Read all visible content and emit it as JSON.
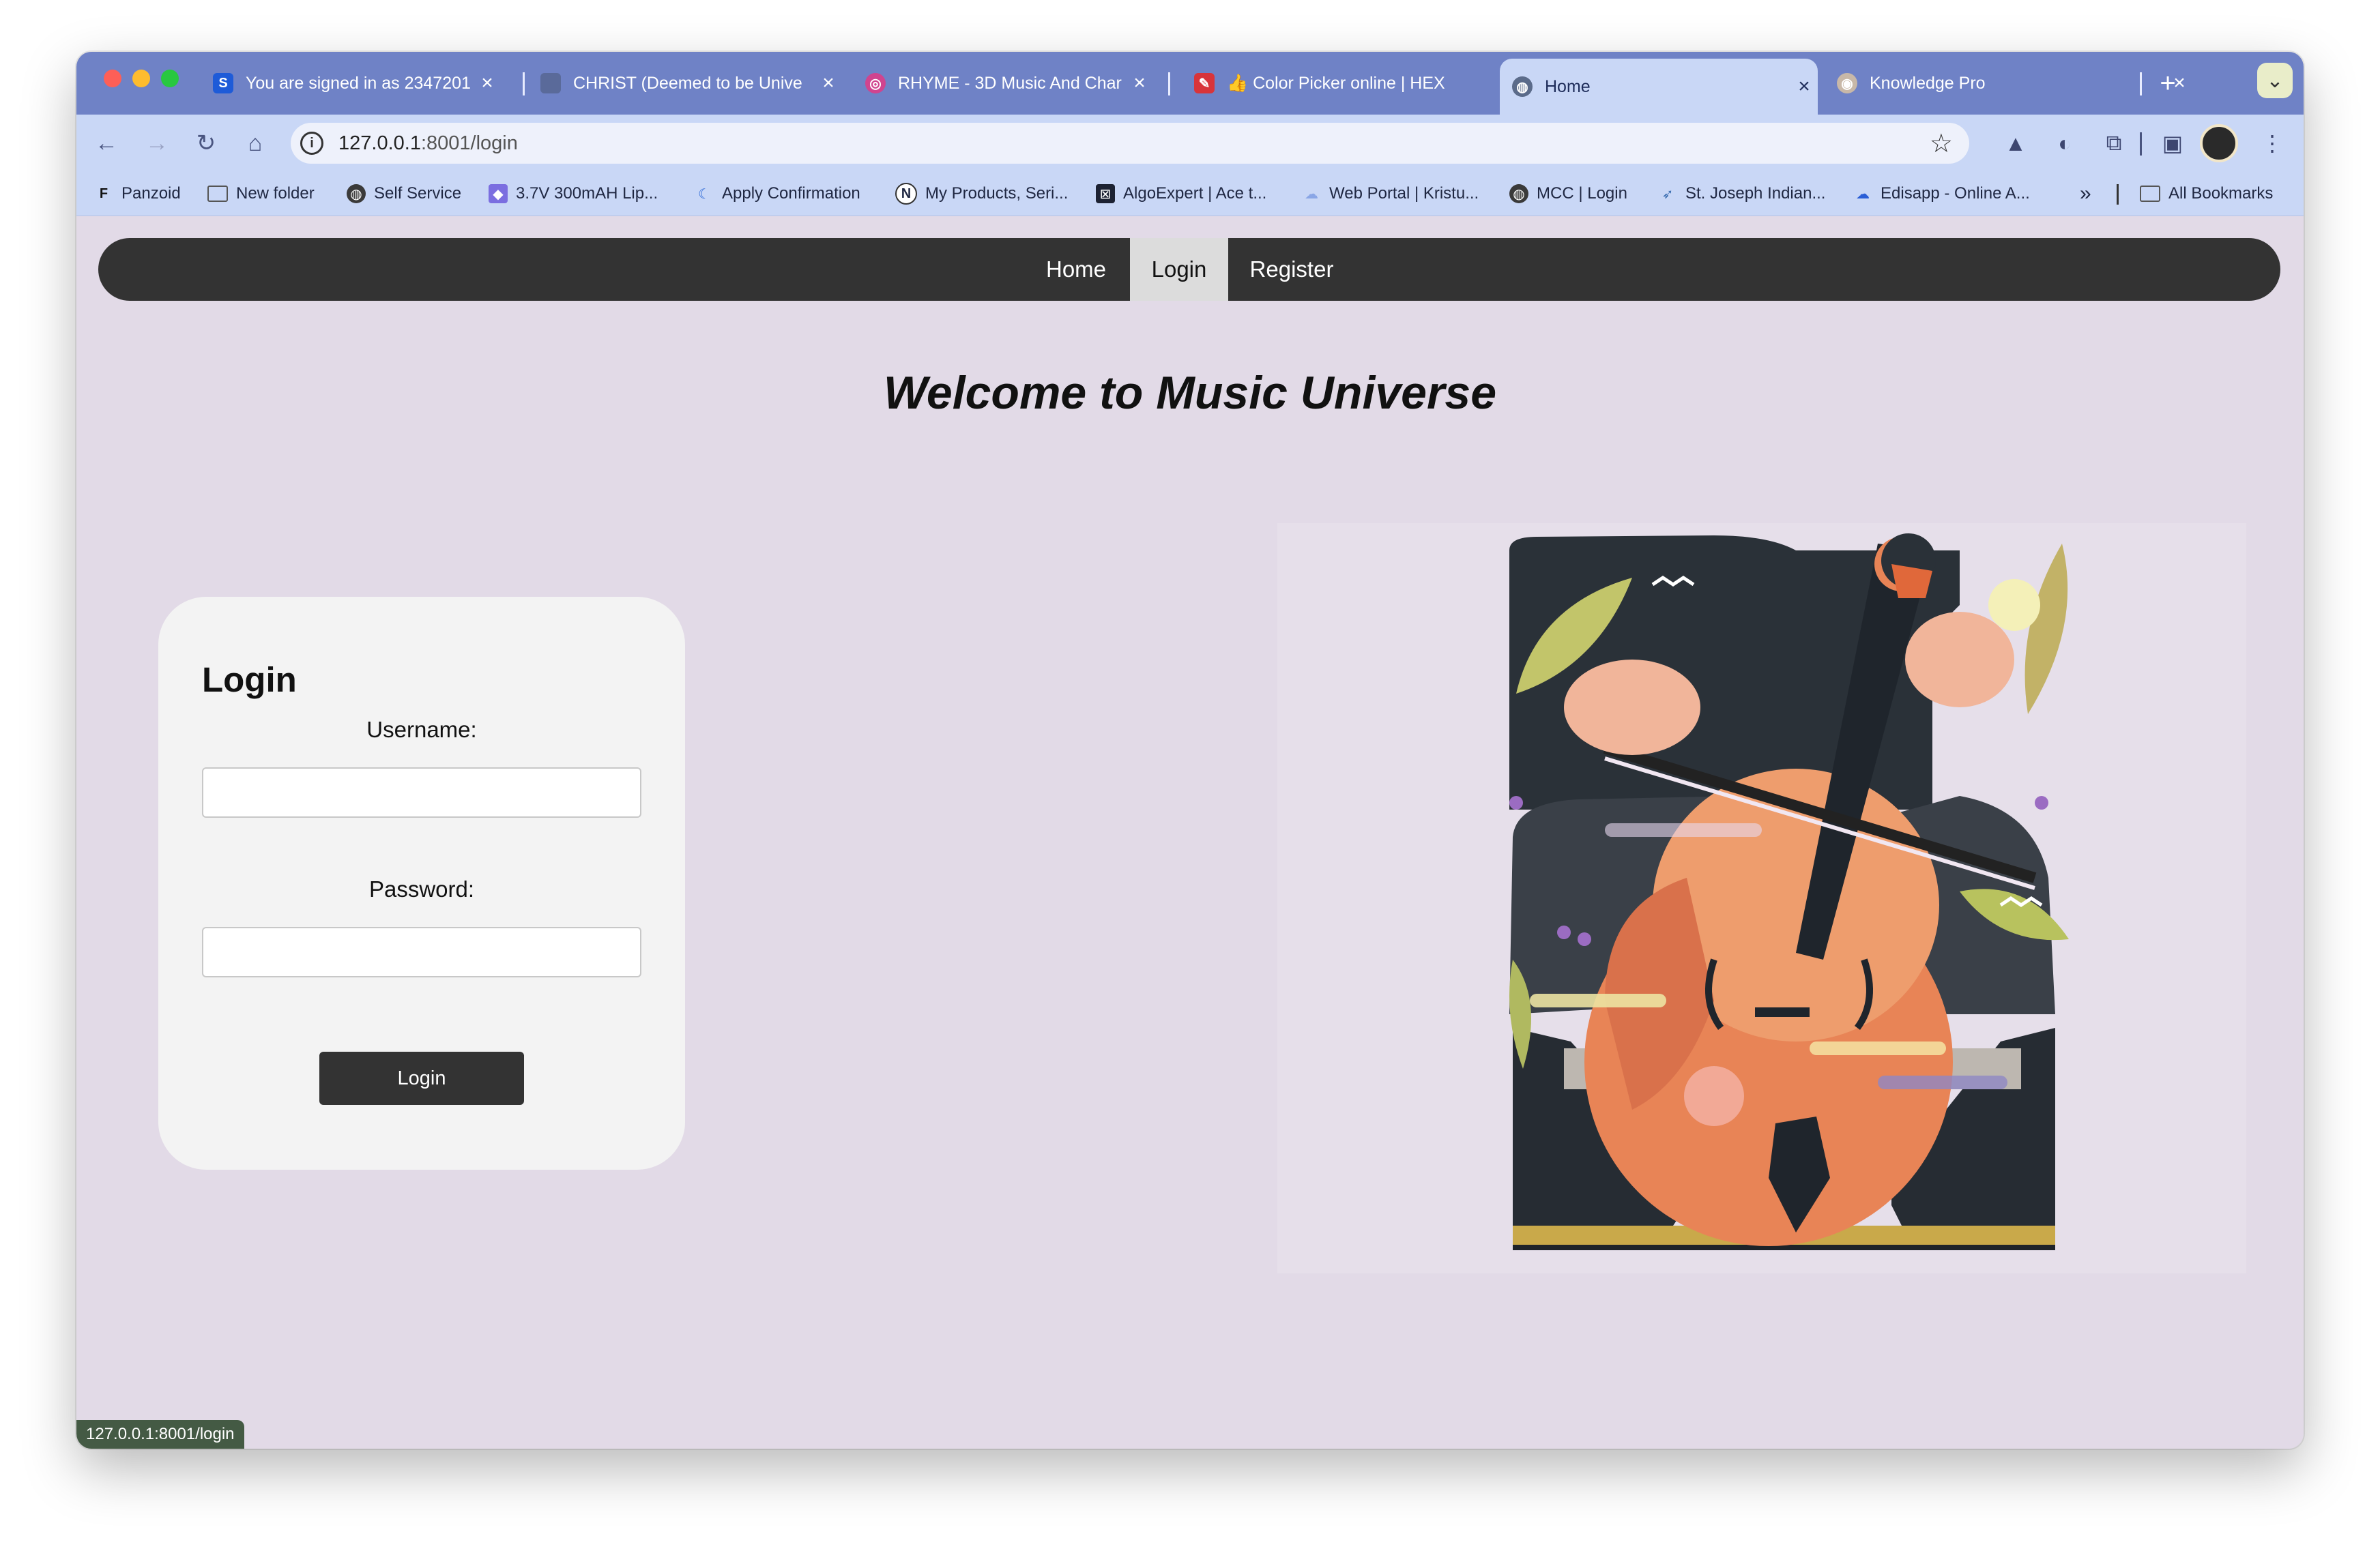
{
  "tabs": [
    {
      "title": "You are signed in as 2347201",
      "favicon": "S",
      "fav_color": "#1e5bd8",
      "active": false
    },
    {
      "title": "CHRIST (Deemed to be Unive",
      "favicon": "",
      "fav_color": "#5a6a9a",
      "active": false
    },
    {
      "title": "RHYME - 3D Music And Char",
      "favicon": "◎",
      "fav_color": "#d0448f",
      "active": false
    },
    {
      "title": "👍 Color Picker online | HEX",
      "favicon": "✎",
      "fav_color": "#d8343a",
      "active": false
    },
    {
      "title": "Home",
      "favicon": "◍",
      "fav_color": "#5b6b8a",
      "active": true
    },
    {
      "title": "Knowledge Pro",
      "favicon": "◉",
      "fav_color": "#c8b8a8",
      "active": false
    }
  ],
  "new_tab_symbol": "+",
  "tab_search_symbol": "⌄",
  "url": {
    "host": "127.0.0.1",
    "rest": ":8001/login"
  },
  "bookmarks": [
    {
      "label": "Panzoid",
      "icon": "F"
    },
    {
      "label": "New folder",
      "icon": "folder"
    },
    {
      "label": "Self Service",
      "icon": "globe"
    },
    {
      "label": "3.7V 300mAH Lip...",
      "icon": "cube"
    },
    {
      "label": "Apply Confirmation",
      "icon": "ruby"
    },
    {
      "label": "My Products, Seri...",
      "icon": "N"
    },
    {
      "label": "AlgoExpert | Ace t...",
      "icon": "X"
    },
    {
      "label": "Web Portal | Kristu...",
      "icon": "cloud"
    },
    {
      "label": "MCC | Login",
      "icon": "globe"
    },
    {
      "label": "St. Joseph Indian...",
      "icon": "bird"
    },
    {
      "label": "Edisapp - Online A...",
      "icon": "cloud"
    }
  ],
  "bookmarks_overflow": "»",
  "all_bookmarks": "All Bookmarks",
  "nav": {
    "home": "Home",
    "login": "Login",
    "register": "Register",
    "active": "Login"
  },
  "welcome": "Welcome to Music Universe",
  "login_form": {
    "title": "Login",
    "username_label": "Username:",
    "username_value": "",
    "password_label": "Password:",
    "password_value": "",
    "submit": "Login"
  },
  "illustration": "cellist illustration",
  "status_url": "127.0.0.1:8001/login",
  "colors": {
    "page_bg": "#e2dae7",
    "navbar": "#333333",
    "card": "#f3f3f3",
    "tabstrip": "#6f82c6",
    "toolbar": "#c9d7f6"
  }
}
